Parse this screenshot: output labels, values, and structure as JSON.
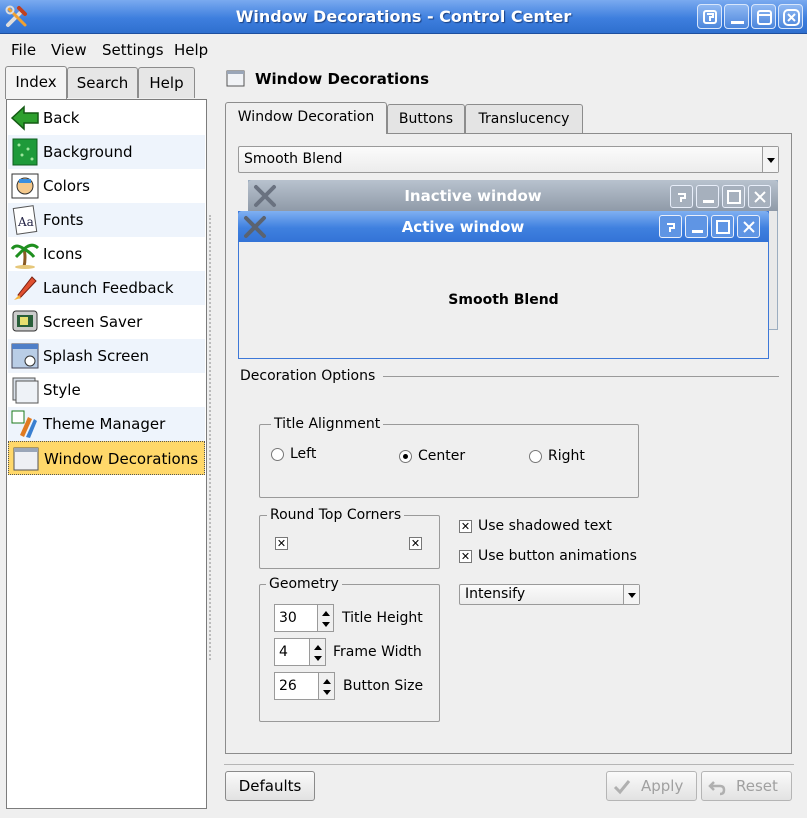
{
  "window": {
    "title": "Window Decorations - Control Center"
  },
  "menubar": {
    "file": "File",
    "view": "View",
    "settings": "Settings",
    "help": "Help"
  },
  "left_tabs": {
    "index": "Index",
    "search": "Search",
    "help": "Help"
  },
  "sidebar": {
    "items": [
      {
        "label": "Back",
        "icon": "back-arrow-icon"
      },
      {
        "label": "Background",
        "icon": "background-icon"
      },
      {
        "label": "Colors",
        "icon": "colors-icon"
      },
      {
        "label": "Fonts",
        "icon": "fonts-icon"
      },
      {
        "label": "Icons",
        "icon": "icons-palm-icon"
      },
      {
        "label": "Launch Feedback",
        "icon": "launch-feedback-icon"
      },
      {
        "label": "Screen Saver",
        "icon": "screen-saver-icon"
      },
      {
        "label": "Splash Screen",
        "icon": "splash-screen-icon"
      },
      {
        "label": "Style",
        "icon": "style-icon"
      },
      {
        "label": "Theme Manager",
        "icon": "theme-manager-icon"
      },
      {
        "label": "Window Decorations",
        "icon": "window-decorations-icon"
      }
    ],
    "selected": "Window Decorations"
  },
  "page": {
    "title": "Window Decorations"
  },
  "tabs": {
    "decoration": "Window Decoration",
    "buttons": "Buttons",
    "translucency": "Translucency"
  },
  "decoration_combo": {
    "value": "Smooth Blend"
  },
  "preview": {
    "inactive_title": "Inactive window",
    "active_title": "Active window",
    "body_text": "Smooth Blend"
  },
  "options": {
    "section_title": "Decoration Options",
    "title_alignment": {
      "label": "Title Alignment",
      "left": "Left",
      "center": "Center",
      "right": "Right",
      "selected": "Center"
    },
    "round_top_corners": {
      "label": "Round Top Corners"
    },
    "use_shadowed_text": "Use shadowed text",
    "use_button_animations": "Use button animations",
    "animation_combo": "Intensify",
    "geometry": {
      "label": "Geometry",
      "title_height_value": "30",
      "title_height_label": "Title Height",
      "frame_width_value": "4",
      "frame_width_label": "Frame Width",
      "button_size_value": "26",
      "button_size_label": "Button Size"
    }
  },
  "footer": {
    "defaults": "Defaults",
    "apply": "Apply",
    "reset": "Reset"
  }
}
